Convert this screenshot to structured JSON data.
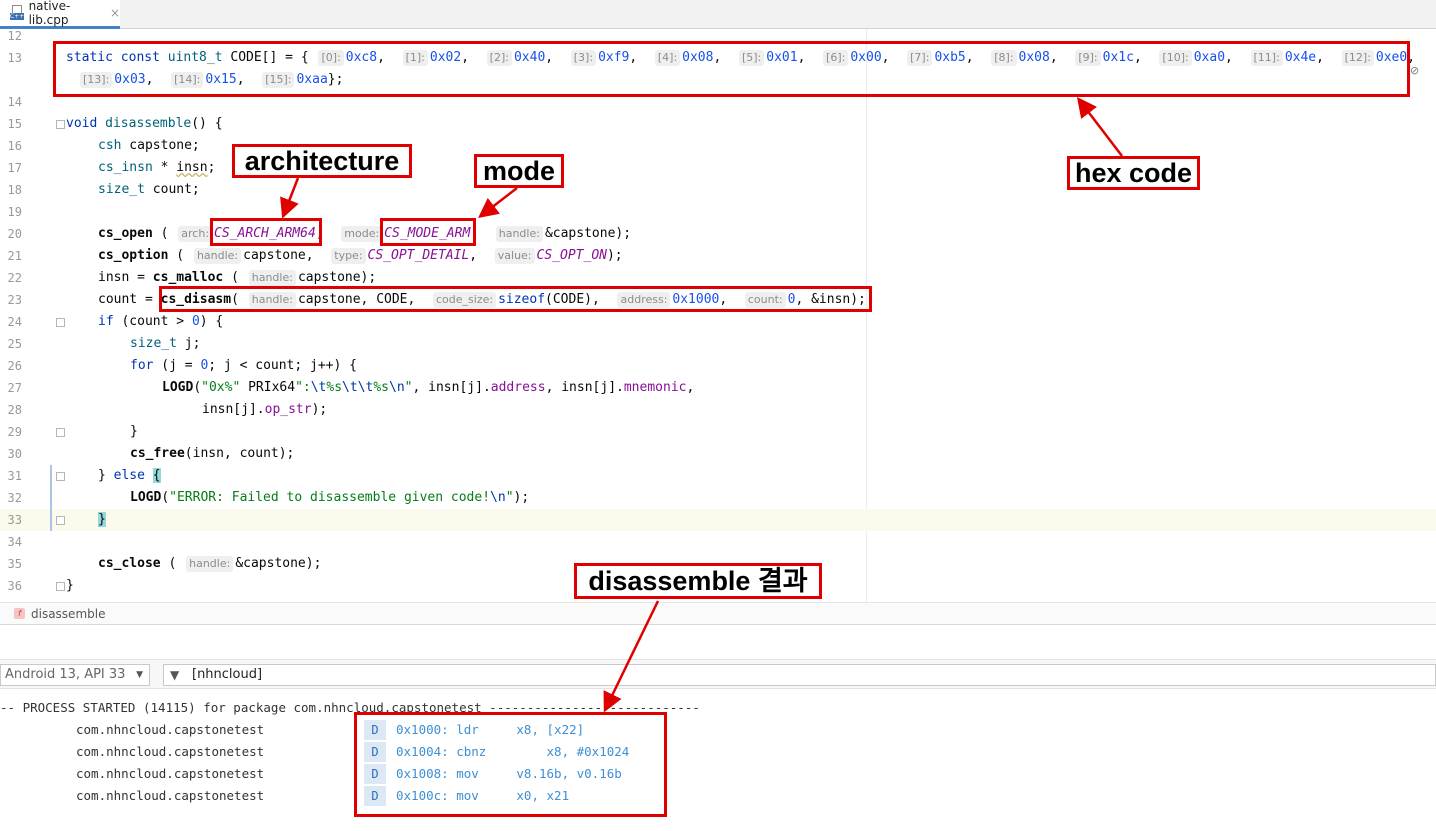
{
  "tab": {
    "filename": "native-lib.cpp",
    "lang_badge": "C++",
    "close": "×"
  },
  "editor": {
    "line_numbers": [
      "12",
      "13",
      "14",
      "15",
      "16",
      "17",
      "18",
      "19",
      "20",
      "21",
      "22",
      "23",
      "24",
      "25",
      "26",
      "27",
      "28",
      "29",
      "30",
      "31",
      "32",
      "33",
      "34",
      "35",
      "36"
    ],
    "line13": {
      "prefix_kw": "static const",
      "type": "uint8_t",
      "decl": "CODE[] = {",
      "items": [
        {
          "idx": "[0]:",
          "val": "0xc8"
        },
        {
          "idx": "[1]:",
          "val": "0x02"
        },
        {
          "idx": "[2]:",
          "val": "0x40"
        },
        {
          "idx": "[3]:",
          "val": "0xf9"
        },
        {
          "idx": "[4]:",
          "val": "0x08"
        },
        {
          "idx": "[5]:",
          "val": "0x01"
        },
        {
          "idx": "[6]:",
          "val": "0x00"
        },
        {
          "idx": "[7]:",
          "val": "0xb5"
        },
        {
          "idx": "[8]:",
          "val": "0x08"
        },
        {
          "idx": "[9]:",
          "val": "0x1c"
        },
        {
          "idx": "[10]:",
          "val": "0xa0"
        },
        {
          "idx": "[11]:",
          "val": "0x4e"
        },
        {
          "idx": "[12]:",
          "val": "0xe0"
        },
        {
          "idx": "[13]:",
          "val": "0x03"
        },
        {
          "idx": "[14]:",
          "val": "0x15"
        },
        {
          "idx": "[15]:",
          "val": "0xaa"
        }
      ],
      "close": "};"
    },
    "line15": {
      "kw": "void",
      "fn": "disassemble",
      "rest": "() {"
    },
    "line16": {
      "type": "csh",
      "rest": " capstone;"
    },
    "line17": {
      "type": "cs_insn",
      "mid": " * ",
      "var": "insn",
      "end": ";"
    },
    "line18": {
      "type": "size_t",
      "rest": " count;"
    },
    "line20": {
      "fn": "cs_open",
      "open": " (",
      "h1": "arch:",
      "a1": "CS_ARCH_ARM64",
      "h2": "mode:",
      "a2": "CS_MODE_ARM",
      "h3": "handle:",
      "a3": "&capstone);"
    },
    "line21": {
      "fn": "cs_option",
      "open": " (",
      "h1": "handle:",
      "a1": "capstone,",
      "h2": "type:",
      "a2": "CS_OPT_DETAIL",
      "h3": "value:",
      "a3": "CS_OPT_ON",
      "end": ");"
    },
    "line22": {
      "pre": "insn = ",
      "fn": "cs_malloc",
      "open": " (",
      "h1": "handle:",
      "a1": "capstone);"
    },
    "line23": {
      "pre": "count = ",
      "fn": "cs_disasm",
      "open": "(",
      "h1": "handle:",
      "a1": "capstone, CODE,",
      "h2": "code_size:",
      "a2kw": "sizeof",
      "a2": "(CODE),",
      "h3": "address:",
      "a3": "0x1000",
      "h4": "count:",
      "a4": "0",
      "end": ", &insn);"
    },
    "line24": {
      "kw": "if",
      "pre": " (count > ",
      "num": "0",
      "end": ") {"
    },
    "line25": {
      "type": "size_t",
      "rest": " j;"
    },
    "line26": {
      "kw": "for",
      "a": " (j = ",
      "num": "0",
      "b": "; j < count; j++) {"
    },
    "line27": {
      "fn": "LOGD",
      "open": "(",
      "s1": "\"0x%\"",
      "mid": " PRIx64",
      "s2a": "\":",
      "e1": "\\t",
      "s2b": "%s",
      "e2": "\\t\\t",
      "s2c": "%s",
      "e3": "\\n",
      "s2d": "\"",
      "rest": ", insn[j].",
      "m1": "address",
      "rest2": ", insn[j].",
      "m2": "mnemonic",
      "end": ","
    },
    "line28": {
      "pre": "insn[j].",
      "m": "op_str",
      "end": ");"
    },
    "line29": {
      "text": "}"
    },
    "line30": {
      "fn": "cs_free",
      "rest": "(insn, count);"
    },
    "line31": {
      "pre": "} ",
      "kw": "else",
      "brace": "{"
    },
    "line32": {
      "fn": "LOGD",
      "open": "(",
      "s": "\"ERROR: Failed to disassemble given code!",
      "e": "\\n",
      "s2": "\"",
      "end": ");"
    },
    "line33": {
      "brace": "}"
    },
    "line35": {
      "fn": "cs_close",
      "open": " (",
      "h1": "handle:",
      "a1": "&capstone);"
    },
    "line36": {
      "text": "}"
    }
  },
  "breadcrumb": {
    "icon": "f",
    "label": "disassemble"
  },
  "logcat": {
    "device": "Android 13, API 33",
    "filter": "[nhncloud]",
    "process_line": "-- PROCESS STARTED (14115) for package com.nhncloud.capstonetest ----------------------------",
    "entries": [
      {
        "pkg": "com.nhncloud.capstonetest",
        "level": "D",
        "msg": "0x1000: ldr     x8, [x22]"
      },
      {
        "pkg": "com.nhncloud.capstonetest",
        "level": "D",
        "msg": "0x1004: cbnz        x8, #0x1024"
      },
      {
        "pkg": "com.nhncloud.capstonetest",
        "level": "D",
        "msg": "0x1008: mov     v8.16b, v0.16b"
      },
      {
        "pkg": "com.nhncloud.capstonetest",
        "level": "D",
        "msg": "0x100c: mov     x0, x21"
      }
    ]
  },
  "annotations": {
    "architecture": "architecture",
    "mode": "mode",
    "hex_code": "hex code",
    "result": "disassemble 결과",
    "color": "#e00000"
  }
}
